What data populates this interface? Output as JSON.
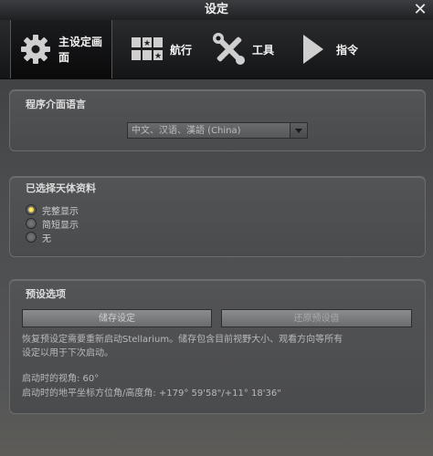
{
  "window": {
    "title": "设定",
    "close_label": "✕"
  },
  "tabs": [
    {
      "label": "主设定画面",
      "icon": "gear-icon",
      "active": true
    },
    {
      "label": "航行",
      "icon": "star-panels-icon",
      "active": false
    },
    {
      "label": "工具",
      "icon": "tools-icon",
      "active": false
    },
    {
      "label": "指令",
      "icon": "play-icon",
      "active": false
    }
  ],
  "language": {
    "title": "程序介面语言",
    "selected": "中文、汉语、漢語 (China)"
  },
  "sky_culture": {
    "title": "已选择天体资料",
    "options": [
      {
        "label": "完整显示",
        "checked": true
      },
      {
        "label": "简短显示",
        "checked": false
      },
      {
        "label": "无",
        "checked": false
      }
    ]
  },
  "defaults": {
    "title": "预设选项",
    "save_label": "储存设定",
    "restore_label": "还原预设值",
    "description_line1": "恢复预设定需要重新启动Stellarium。储存包含目前视野大小、观看方向等所有",
    "description_line2": "设定以用于下次启动。",
    "fov_text": "启动时的视角: 60°",
    "direction_text": "启动时的地平坐标方位角/高度角: +179° 59'58\"/+11° 18'36\""
  },
  "colors": {
    "radio_checked": "#e0b800",
    "panel_border": "#6a6b6d"
  }
}
